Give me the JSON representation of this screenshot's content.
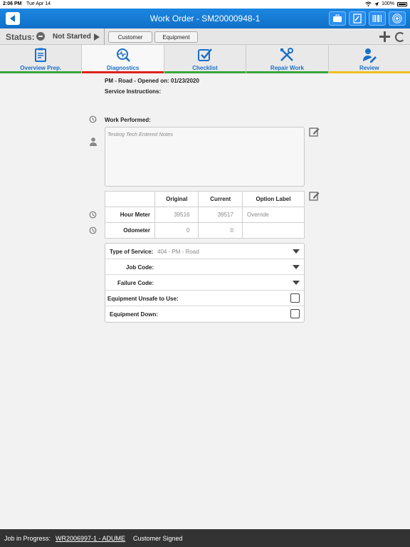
{
  "statusbar": {
    "time": "2:06 PM",
    "date": "Tue Apr 14",
    "battery": "100%"
  },
  "navbar": {
    "title": "Work Order - SM20000948-1"
  },
  "toolbar": {
    "status_label": "Status:",
    "status_value": "Not Started",
    "customer_label": "Customer",
    "equipment_label": "Equipment"
  },
  "tabs": [
    {
      "label": "Overview Prep.",
      "icon": "clipboard-icon",
      "bar_color": "#3aa63a"
    },
    {
      "label": "Diagnostics",
      "icon": "diagnostics-icon",
      "bar_color": "#e02020"
    },
    {
      "label": "Checklist",
      "icon": "checklist-icon",
      "bar_color": "#3aa63a"
    },
    {
      "label": "Repair Work",
      "icon": "tools-icon",
      "bar_color": "#3aa63a"
    },
    {
      "label": "Review",
      "icon": "review-icon",
      "bar_color": "#f0c020"
    }
  ],
  "content": {
    "opened": "PM - Road - Opened on: 01/23/2020",
    "service_instructions": "Service Instructions:",
    "work_performed": "Work Performed:",
    "notes_text": "Testing Tech Entered Notes"
  },
  "meters": {
    "headers": [
      "Original",
      "Current",
      "Option Label"
    ],
    "rows": [
      {
        "label": "Hour Meter",
        "original": "39516",
        "current": "39517",
        "option": "Override"
      },
      {
        "label": "Odometer",
        "original": "0",
        "current": "0",
        "option": ""
      }
    ]
  },
  "fields": {
    "type_of_service_label": "Type of Service:",
    "type_of_service_value": "404 - PM - Road",
    "job_code_label": "Job Code:",
    "failure_code_label": "Failure Code:",
    "unsafe_label": "Equipment Unsafe to Use:",
    "down_label": "Equipment Down:"
  },
  "footer": {
    "label": "Job in Progress:",
    "link": "WR2006997-1 - ADUME",
    "signed": "Customer Signed"
  }
}
